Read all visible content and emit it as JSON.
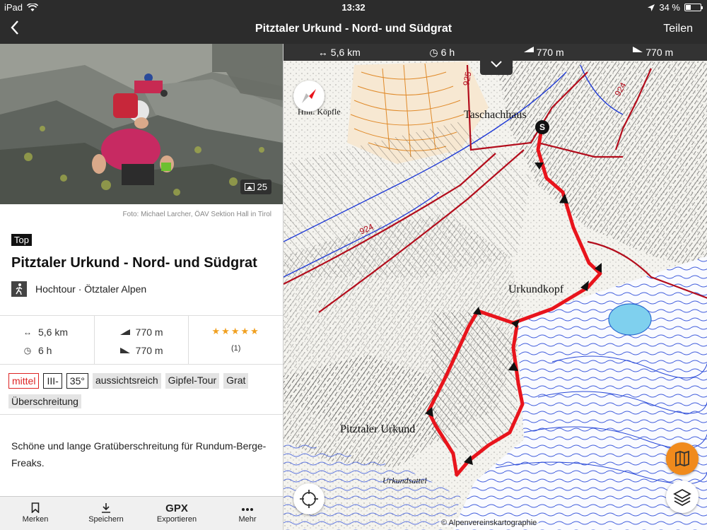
{
  "statusbar": {
    "device": "iPad",
    "time": "13:32",
    "battery": "34 %"
  },
  "navbar": {
    "back_icon": "chevron-left-icon",
    "title": "Pitztaler Urkund - Nord- und Südgrat",
    "share_label": "Teilen"
  },
  "photo": {
    "count": "25",
    "credit": "Foto: Michael Larcher, ÖAV Sektion Hall in Tirol"
  },
  "tour": {
    "badge": "Top",
    "title": "Pitztaler Urkund - Nord- und Südgrat",
    "type": "Hochtour · Ötztaler Alpen",
    "distance": "5,6 km",
    "duration": "6 h",
    "ascent": "770 m",
    "descent": "770 m",
    "rating_count": "(1)",
    "tags": [
      {
        "label": "mittel",
        "style": "red"
      },
      {
        "label": "III-",
        "style": "outline"
      },
      {
        "label": "35°",
        "style": "outline"
      },
      {
        "label": "aussichtsreich",
        "style": "grey"
      },
      {
        "label": "Gipfel-Tour",
        "style": "grey"
      },
      {
        "label": "Grat",
        "style": "grey"
      },
      {
        "label": "Überschreitung",
        "style": "grey"
      }
    ],
    "description": "Schöne und lange Gratüberschreitung für Rundum-Berge-Freaks."
  },
  "tabbar": {
    "merken": "Merken",
    "speichern": "Speichern",
    "gpx": "GPX",
    "exportieren": "Exportieren",
    "mehr": "Mehr"
  },
  "map": {
    "distance": "5,6 km",
    "duration": "6 h",
    "ascent": "770 m",
    "descent": "770 m",
    "copyright": "© Alpenvereinskartographie",
    "labels": {
      "taschachhaus": "Taschachhaus",
      "urkundkopf": "Urkundkopf",
      "pitztaler_urkund": "Pitztaler Urkund",
      "urkundsattel": "Urkundsattel",
      "hint_koepfle": "Hint. Köpfle",
      "trail_925": "925",
      "trail_924a": "924",
      "trail_924b": "924",
      "start_marker": "S"
    }
  },
  "colors": {
    "route": "#e8141c",
    "accent": "#f08a1c",
    "bar": "#2c2c2c"
  }
}
